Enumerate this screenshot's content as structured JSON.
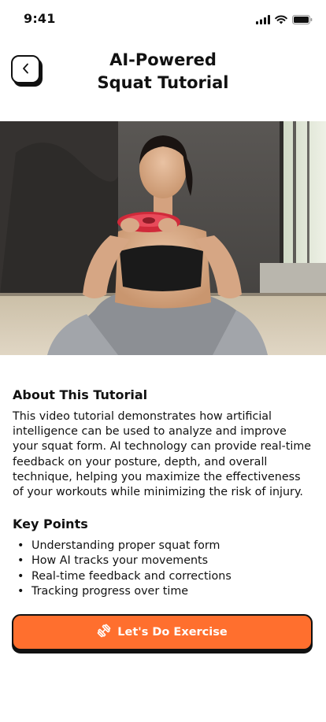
{
  "status_bar": {
    "time": "9:41",
    "icons": [
      "signal-icon",
      "wifi-icon",
      "battery-icon"
    ]
  },
  "header": {
    "back_icon": "chevron-left-icon",
    "title": "AI-Powered\nSquat Tutorial"
  },
  "hero": {
    "image": "woman-doing-sumo-squat-with-weight-plate"
  },
  "about": {
    "title": "About This Tutorial",
    "text": "This video tutorial demonstrates how artificial intelligence can be used to analyze and improve your squat form. AI technology can provide real-time feedback on your posture, depth, and overall technique, helping you maximize the effectiveness of your workouts while minimizing the risk of injury."
  },
  "key_points": {
    "title": "Key Points",
    "items": [
      "Understanding proper squat form",
      "How AI tracks your movements",
      "Real-time feedback and corrections",
      "Tracking progress over time"
    ]
  },
  "cta": {
    "icon": "dumbbell-icon",
    "label": "Let's Do Exercise"
  },
  "colors": {
    "accent": "#ff6f2e",
    "text": "#111111",
    "background": "#ffffff"
  }
}
